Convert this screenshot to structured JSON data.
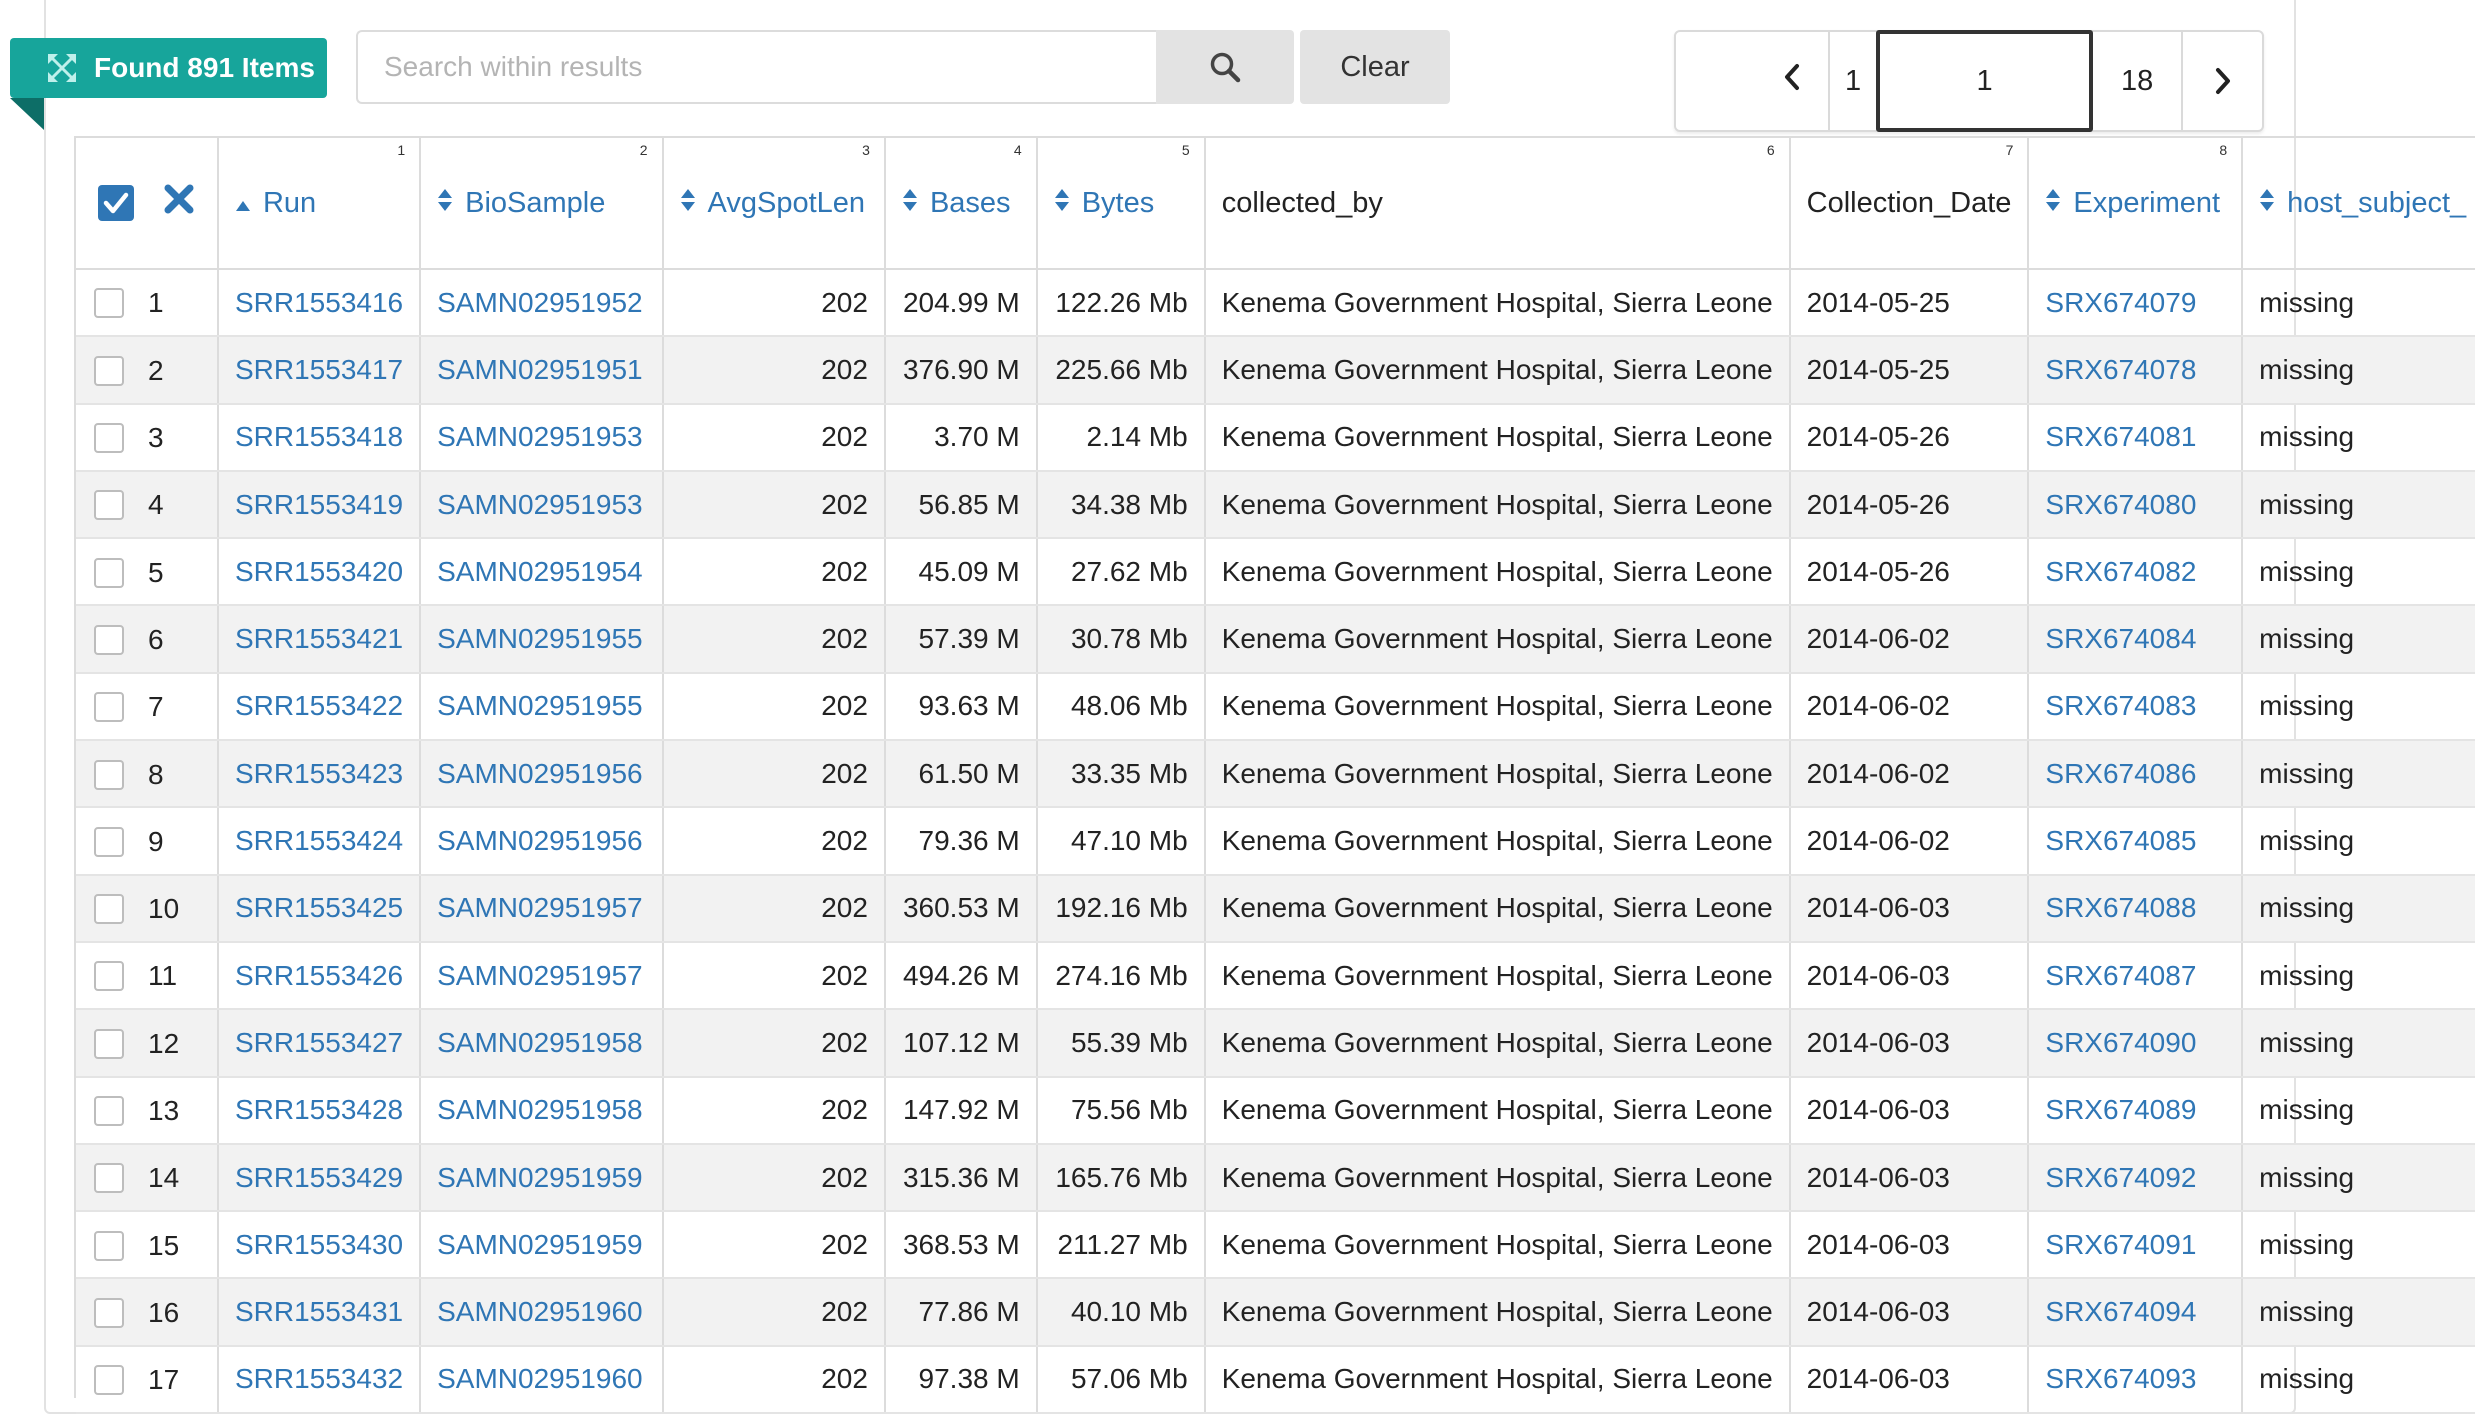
{
  "found_badge": {
    "label": "Found 891 Items"
  },
  "search": {
    "placeholder": "Search within results",
    "clear_label": "Clear"
  },
  "pager": {
    "first": "1",
    "current": "1",
    "last": "18"
  },
  "columns": [
    {
      "label": "Run",
      "num": "1"
    },
    {
      "label": "BioSample",
      "num": "2"
    },
    {
      "label": "AvgSpotLen",
      "num": "3"
    },
    {
      "label": "Bases",
      "num": "4"
    },
    {
      "label": "Bytes",
      "num": "5"
    },
    {
      "label": "collected_by",
      "num": "6"
    },
    {
      "label": "Collection_Date",
      "num": "7"
    },
    {
      "label": "Experiment",
      "num": "8"
    },
    {
      "label": "host_subject_",
      "num": ""
    }
  ],
  "rows": [
    {
      "n": "1",
      "run": "SRR1553416",
      "biosample": "SAMN02951952",
      "avgspotlen": "202",
      "bases": "204.99 M",
      "bytes": "122.26 Mb",
      "collected_by": "Kenema Government Hospital, Sierra Leone",
      "date": "2014-05-25",
      "experiment": "SRX674079",
      "host": "missing"
    },
    {
      "n": "2",
      "run": "SRR1553417",
      "biosample": "SAMN02951951",
      "avgspotlen": "202",
      "bases": "376.90 M",
      "bytes": "225.66 Mb",
      "collected_by": "Kenema Government Hospital, Sierra Leone",
      "date": "2014-05-25",
      "experiment": "SRX674078",
      "host": "missing"
    },
    {
      "n": "3",
      "run": "SRR1553418",
      "biosample": "SAMN02951953",
      "avgspotlen": "202",
      "bases": "3.70 M",
      "bytes": "2.14 Mb",
      "collected_by": "Kenema Government Hospital, Sierra Leone",
      "date": "2014-05-26",
      "experiment": "SRX674081",
      "host": "missing"
    },
    {
      "n": "4",
      "run": "SRR1553419",
      "biosample": "SAMN02951953",
      "avgspotlen": "202",
      "bases": "56.85 M",
      "bytes": "34.38 Mb",
      "collected_by": "Kenema Government Hospital, Sierra Leone",
      "date": "2014-05-26",
      "experiment": "SRX674080",
      "host": "missing"
    },
    {
      "n": "5",
      "run": "SRR1553420",
      "biosample": "SAMN02951954",
      "avgspotlen": "202",
      "bases": "45.09 M",
      "bytes": "27.62 Mb",
      "collected_by": "Kenema Government Hospital, Sierra Leone",
      "date": "2014-05-26",
      "experiment": "SRX674082",
      "host": "missing"
    },
    {
      "n": "6",
      "run": "SRR1553421",
      "biosample": "SAMN02951955",
      "avgspotlen": "202",
      "bases": "57.39 M",
      "bytes": "30.78 Mb",
      "collected_by": "Kenema Government Hospital, Sierra Leone",
      "date": "2014-06-02",
      "experiment": "SRX674084",
      "host": "missing"
    },
    {
      "n": "7",
      "run": "SRR1553422",
      "biosample": "SAMN02951955",
      "avgspotlen": "202",
      "bases": "93.63 M",
      "bytes": "48.06 Mb",
      "collected_by": "Kenema Government Hospital, Sierra Leone",
      "date": "2014-06-02",
      "experiment": "SRX674083",
      "host": "missing"
    },
    {
      "n": "8",
      "run": "SRR1553423",
      "biosample": "SAMN02951956",
      "avgspotlen": "202",
      "bases": "61.50 M",
      "bytes": "33.35 Mb",
      "collected_by": "Kenema Government Hospital, Sierra Leone",
      "date": "2014-06-02",
      "experiment": "SRX674086",
      "host": "missing"
    },
    {
      "n": "9",
      "run": "SRR1553424",
      "biosample": "SAMN02951956",
      "avgspotlen": "202",
      "bases": "79.36 M",
      "bytes": "47.10 Mb",
      "collected_by": "Kenema Government Hospital, Sierra Leone",
      "date": "2014-06-02",
      "experiment": "SRX674085",
      "host": "missing"
    },
    {
      "n": "10",
      "run": "SRR1553425",
      "biosample": "SAMN02951957",
      "avgspotlen": "202",
      "bases": "360.53 M",
      "bytes": "192.16 Mb",
      "collected_by": "Kenema Government Hospital, Sierra Leone",
      "date": "2014-06-03",
      "experiment": "SRX674088",
      "host": "missing"
    },
    {
      "n": "11",
      "run": "SRR1553426",
      "biosample": "SAMN02951957",
      "avgspotlen": "202",
      "bases": "494.26 M",
      "bytes": "274.16 Mb",
      "collected_by": "Kenema Government Hospital, Sierra Leone",
      "date": "2014-06-03",
      "experiment": "SRX674087",
      "host": "missing"
    },
    {
      "n": "12",
      "run": "SRR1553427",
      "biosample": "SAMN02951958",
      "avgspotlen": "202",
      "bases": "107.12 M",
      "bytes": "55.39 Mb",
      "collected_by": "Kenema Government Hospital, Sierra Leone",
      "date": "2014-06-03",
      "experiment": "SRX674090",
      "host": "missing"
    },
    {
      "n": "13",
      "run": "SRR1553428",
      "biosample": "SAMN02951958",
      "avgspotlen": "202",
      "bases": "147.92 M",
      "bytes": "75.56 Mb",
      "collected_by": "Kenema Government Hospital, Sierra Leone",
      "date": "2014-06-03",
      "experiment": "SRX674089",
      "host": "missing"
    },
    {
      "n": "14",
      "run": "SRR1553429",
      "biosample": "SAMN02951959",
      "avgspotlen": "202",
      "bases": "315.36 M",
      "bytes": "165.76 Mb",
      "collected_by": "Kenema Government Hospital, Sierra Leone",
      "date": "2014-06-03",
      "experiment": "SRX674092",
      "host": "missing"
    },
    {
      "n": "15",
      "run": "SRR1553430",
      "biosample": "SAMN02951959",
      "avgspotlen": "202",
      "bases": "368.53 M",
      "bytes": "211.27 Mb",
      "collected_by": "Kenema Government Hospital, Sierra Leone",
      "date": "2014-06-03",
      "experiment": "SRX674091",
      "host": "missing"
    },
    {
      "n": "16",
      "run": "SRR1553431",
      "biosample": "SAMN02951960",
      "avgspotlen": "202",
      "bases": "77.86 M",
      "bytes": "40.10 Mb",
      "collected_by": "Kenema Government Hospital, Sierra Leone",
      "date": "2014-06-03",
      "experiment": "SRX674094",
      "host": "missing"
    },
    {
      "n": "17",
      "run": "SRR1553432",
      "biosample": "SAMN02951960",
      "avgspotlen": "202",
      "bases": "97.38 M",
      "bytes": "57.06 Mb",
      "collected_by": "Kenema Government Hospital, Sierra Leone",
      "date": "2014-06-03",
      "experiment": "SRX674093",
      "host": "missing"
    }
  ],
  "colors": {
    "accent": "#17a59b",
    "link": "#2f76b5"
  },
  "icons": {
    "badge": "expand-arrows-icon",
    "search": "magnifier-icon",
    "prev": "chevron-left-icon",
    "next": "chevron-right-icon",
    "select_all": "checked-box-icon",
    "clear_selection": "x-icon"
  }
}
